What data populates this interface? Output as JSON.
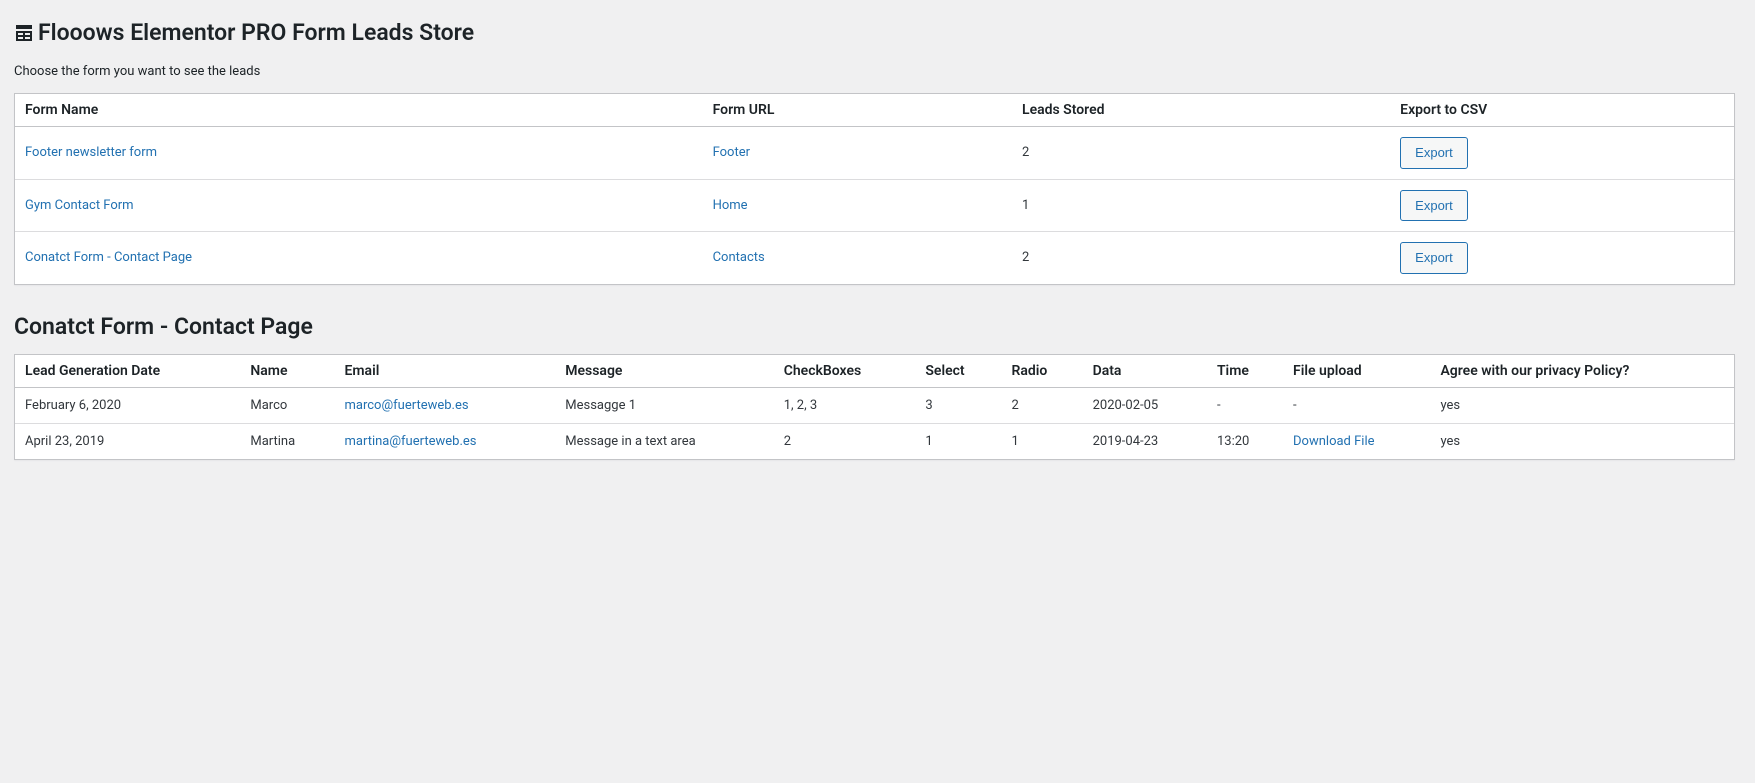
{
  "page_title": "Flooows Elementor PRO Form Leads Store",
  "instruction": "Choose the form you want to see the leads",
  "forms_table": {
    "headers": {
      "form_name": "Form Name",
      "form_url": "Form URL",
      "leads_stored": "Leads Stored",
      "export": "Export to CSV"
    },
    "rows": [
      {
        "name": "Footer newsletter form",
        "url": "Footer",
        "stored": "2",
        "export": "Export"
      },
      {
        "name": "Gym Contact Form",
        "url": "Home",
        "stored": "1",
        "export": "Export"
      },
      {
        "name": "Conatct Form - Contact Page",
        "url": "Contacts",
        "stored": "2",
        "export": "Export"
      }
    ]
  },
  "section_title": "Conatct Form - Contact Page",
  "leads_table": {
    "headers": {
      "date": "Lead Generation Date",
      "name": "Name",
      "email": "Email",
      "message": "Message",
      "checkboxes": "CheckBoxes",
      "select": "Select",
      "radio": "Radio",
      "data": "Data",
      "time": "Time",
      "file": "File upload",
      "agree": "Agree with our privacy Policy?"
    },
    "rows": [
      {
        "date": "February 6, 2020",
        "name": "Marco",
        "email": "marco@fuerteweb.es",
        "message": "Messagge 1",
        "checkboxes": "1, 2, 3",
        "select": "3",
        "radio": "2",
        "data": "2020-02-05",
        "time": "-",
        "file": "-",
        "file_is_link": false,
        "agree": "yes"
      },
      {
        "date": "April 23, 2019",
        "name": "Martina",
        "email": "martina@fuerteweb.es",
        "message": "Message in a text area",
        "checkboxes": "2",
        "select": "1",
        "radio": "1",
        "data": "2019-04-23",
        "time": "13:20",
        "file": "Download File",
        "file_is_link": true,
        "agree": "yes"
      }
    ]
  }
}
